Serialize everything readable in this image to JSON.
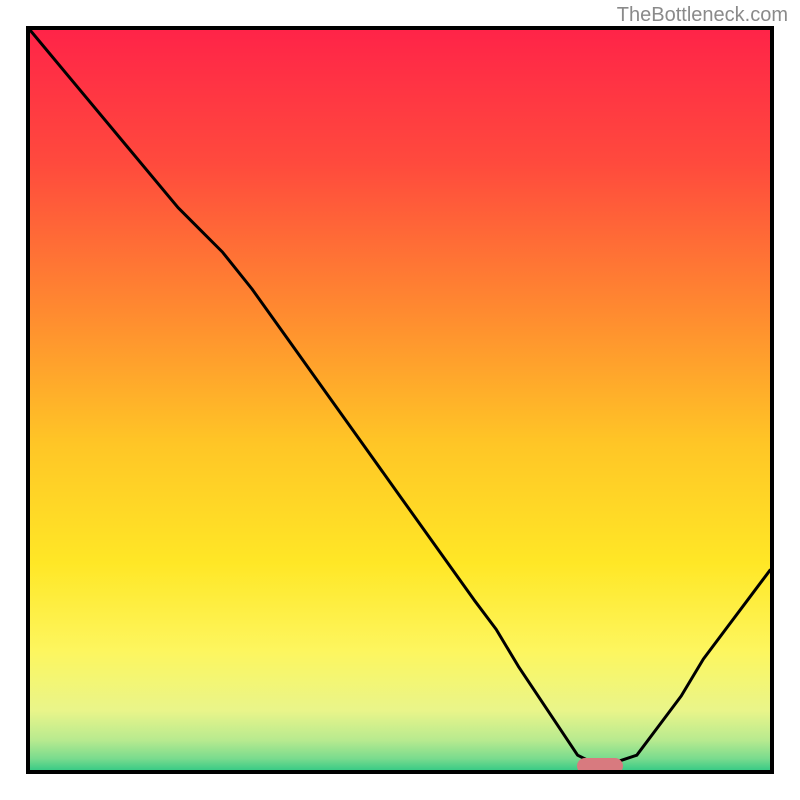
{
  "attribution": "TheBottleneck.com",
  "chart_data": {
    "type": "line",
    "x": [
      0.0,
      0.05,
      0.1,
      0.15,
      0.2,
      0.23,
      0.26,
      0.3,
      0.35,
      0.4,
      0.45,
      0.5,
      0.55,
      0.6,
      0.63,
      0.66,
      0.7,
      0.74,
      0.76,
      0.79,
      0.82,
      0.85,
      0.88,
      0.91,
      0.94,
      0.97,
      1.0
    ],
    "y": [
      1.0,
      0.94,
      0.88,
      0.82,
      0.76,
      0.73,
      0.7,
      0.65,
      0.58,
      0.51,
      0.44,
      0.37,
      0.3,
      0.23,
      0.19,
      0.14,
      0.08,
      0.02,
      0.01,
      0.01,
      0.02,
      0.06,
      0.1,
      0.15,
      0.19,
      0.23,
      0.27
    ],
    "title": "",
    "xlabel": "",
    "ylabel": "",
    "xlim": [
      0,
      1
    ],
    "ylim": [
      0,
      1
    ],
    "marker": {
      "x": 0.77,
      "y": 0.005
    },
    "notes": "Axes are unlabeled; x and y are normalized 0–1 read from the square plot frame. y is the height of the black curve above the bottom of the frame. The background is a vertical gradient from red (top) through orange, yellow, to green at the very bottom."
  },
  "gradient": {
    "stops": [
      {
        "offset": 0.0,
        "color": "#ff2448"
      },
      {
        "offset": 0.18,
        "color": "#ff4a3d"
      },
      {
        "offset": 0.38,
        "color": "#ff8a30"
      },
      {
        "offset": 0.56,
        "color": "#ffc626"
      },
      {
        "offset": 0.72,
        "color": "#ffe726"
      },
      {
        "offset": 0.84,
        "color": "#fdf65f"
      },
      {
        "offset": 0.92,
        "color": "#e9f58a"
      },
      {
        "offset": 0.96,
        "color": "#b7ea8f"
      },
      {
        "offset": 0.985,
        "color": "#78db8e"
      },
      {
        "offset": 1.0,
        "color": "#3acb86"
      }
    ]
  }
}
